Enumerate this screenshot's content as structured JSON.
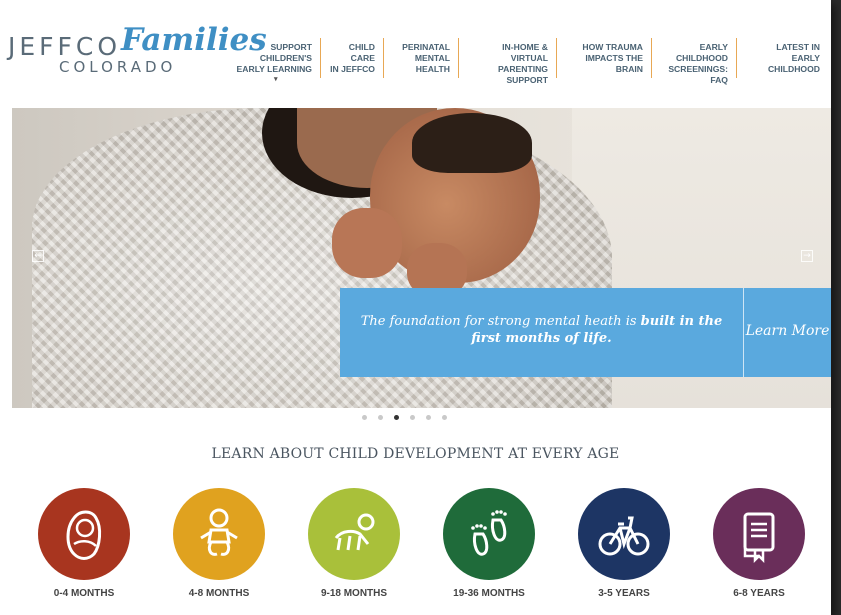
{
  "logo": {
    "word1": "JEFFCO",
    "word2": "Families",
    "word3": "COLORADO"
  },
  "nav": [
    {
      "line1": "SUPPORT CHILDREN'S",
      "line2": "EARLY LEARNING",
      "dropdown": true
    },
    {
      "line1": "CHILD CARE",
      "line2": "IN JEFFCO"
    },
    {
      "line1": "PERINATAL",
      "line2": "MENTAL HEALTH"
    },
    {
      "line1": "IN-HOME & VIRTUAL",
      "line2": "PARENTING SUPPORT"
    },
    {
      "line1": "HOW TRAUMA",
      "line2": "IMPACTS THE BRAIN"
    },
    {
      "line1": "EARLY CHILDHOOD",
      "line2": "SCREENINGS: FAQ"
    },
    {
      "line1": "LATEST IN",
      "line2": "EARLY CHILDHOOD"
    }
  ],
  "hero": {
    "caption_plain": "The foundation for strong mental heath is ",
    "caption_bold": "built in the first months of life.",
    "cta": "Learn More",
    "prev_icon": "arrow-left-icon",
    "next_icon": "arrow-right-icon",
    "slide_count": 6,
    "active_slide": 3
  },
  "section": {
    "title": "LEARN ABOUT CHILD DEVELOPMENT AT EVERY AGE"
  },
  "ages": [
    {
      "label": "0-4 MONTHS",
      "color": "#a8351f",
      "icon": "newborn-icon"
    },
    {
      "label": "4-8 MONTHS",
      "color": "#e0a21f",
      "icon": "baby-icon"
    },
    {
      "label": "9-18 MONTHS",
      "color": "#a9c03a",
      "icon": "crawling-baby-icon"
    },
    {
      "label": "19-36 MONTHS",
      "color": "#1f6b3a",
      "icon": "footprints-icon"
    },
    {
      "label": "3-5 YEARS",
      "color": "#1d3564",
      "icon": "bicycle-icon"
    },
    {
      "label": "6-8 YEARS",
      "color": "#6a2e5a",
      "icon": "book-icon"
    }
  ],
  "colors": {
    "accent_border": "#e8a855",
    "caption_bg": "#5aa9de",
    "logo_blue": "#3f8fc4",
    "logo_gray": "#5a6b78"
  }
}
